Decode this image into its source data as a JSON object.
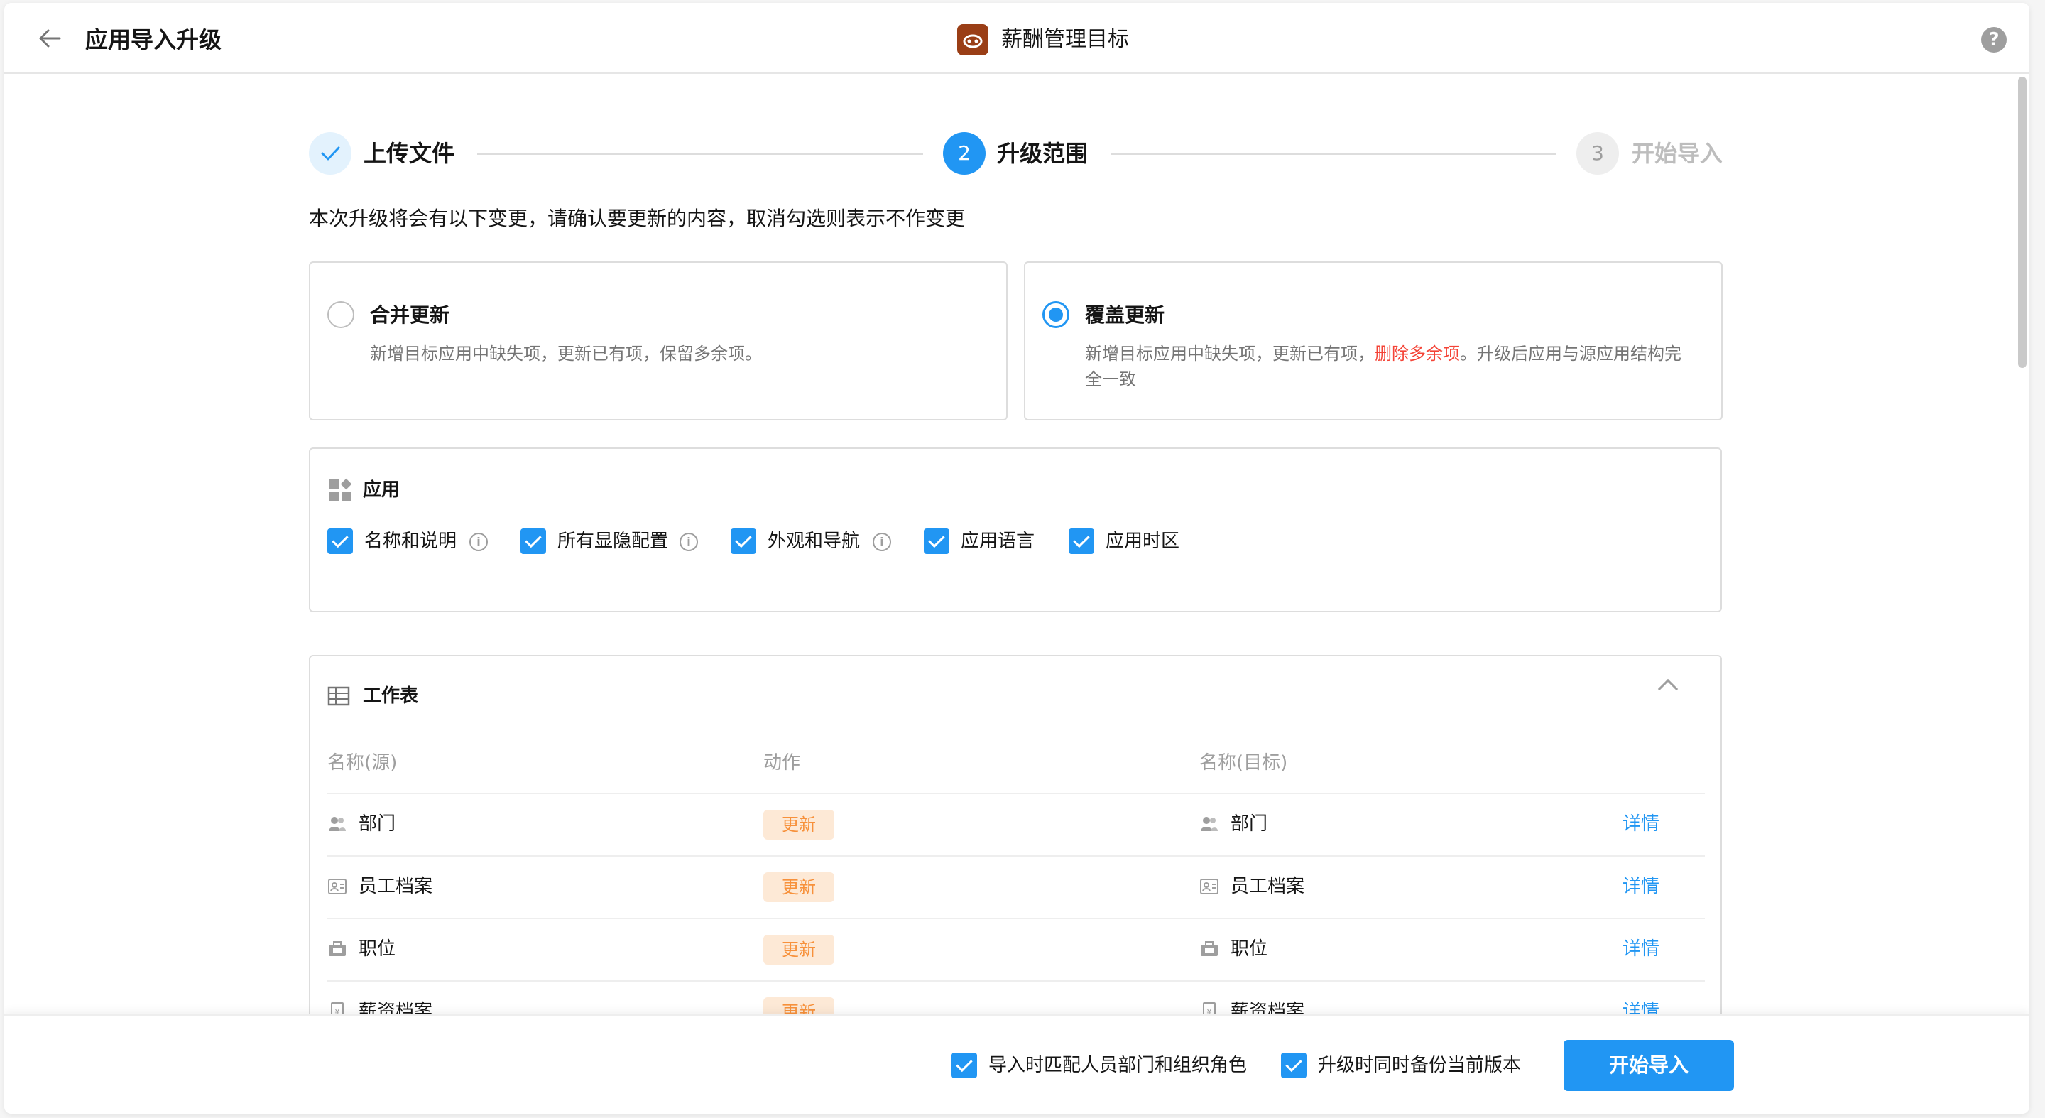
{
  "header": {
    "title": "应用导入升级",
    "app_name": "薪酬管理目标",
    "help": "?"
  },
  "steps": [
    {
      "index": "1",
      "label": "上传文件",
      "state": "done"
    },
    {
      "index": "2",
      "label": "升级范围",
      "state": "active"
    },
    {
      "index": "3",
      "label": "开始导入",
      "state": "pending"
    }
  ],
  "intro": "本次升级将会有以下变更，请确认要更新的内容，取消勾选则表示不作变更",
  "options": {
    "merge": {
      "title": "合并更新",
      "desc": "新增目标应用中缺失项，更新已有项，保留多余项。",
      "selected": false
    },
    "overwrite": {
      "title": "覆盖更新",
      "desc_before": "新增目标应用中缺失项，更新已有项，",
      "desc_red": "删除多余项",
      "desc_after": "。升级后应用与源应用结构完全一致",
      "selected": true
    }
  },
  "app_section": {
    "title": "应用",
    "items": [
      {
        "label": "名称和说明",
        "checked": true,
        "info": true
      },
      {
        "label": "所有显隐配置",
        "checked": true,
        "info": true
      },
      {
        "label": "外观和导航",
        "checked": true,
        "info": true
      },
      {
        "label": "应用语言",
        "checked": true,
        "info": false
      },
      {
        "label": "应用时区",
        "checked": true,
        "info": false
      }
    ]
  },
  "worksheet_section": {
    "title": "工作表",
    "columns": {
      "source": "名称(源)",
      "action": "动作",
      "target": "名称(目标)"
    },
    "rows": [
      {
        "source": "部门",
        "action": "更新",
        "target": "部门",
        "detail": "详情",
        "icon": "group-icon"
      },
      {
        "source": "员工档案",
        "action": "更新",
        "target": "员工档案",
        "detail": "详情",
        "icon": "id-card-icon"
      },
      {
        "source": "职位",
        "action": "更新",
        "target": "职位",
        "detail": "详情",
        "icon": "briefcase-icon"
      },
      {
        "source": "薪资档案",
        "action": "更新",
        "target": "薪资档案",
        "detail": "详情",
        "icon": "money-doc-icon"
      }
    ]
  },
  "footer": {
    "match_label": "导入时匹配人员部门和组织角色",
    "backup_label": "升级时同时备份当前版本",
    "start_button": "开始导入"
  },
  "colors": {
    "primary": "#2196f3",
    "warning_bg": "#fde9d6",
    "warning_text": "#f7913b",
    "danger": "#f44336",
    "logo": "#9a3e16"
  }
}
